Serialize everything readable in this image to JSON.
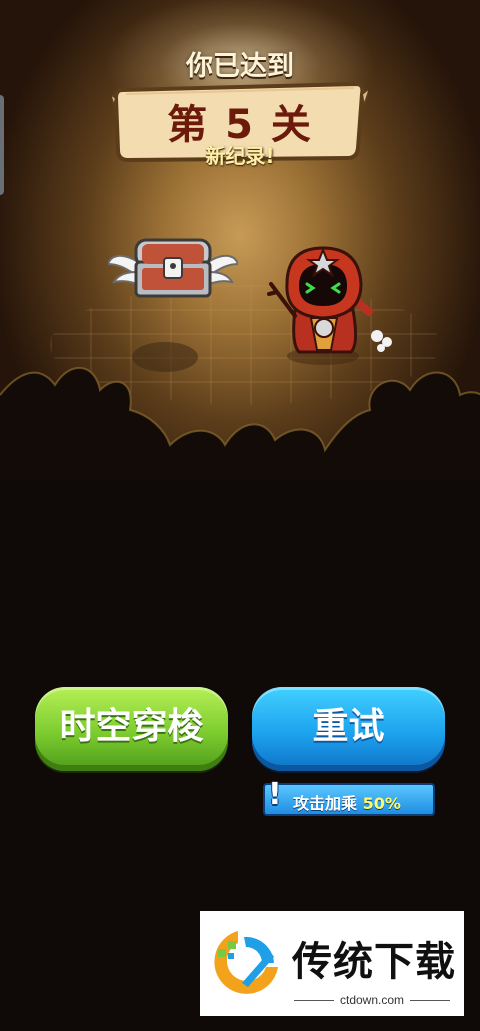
{
  "result": {
    "heading": "你已达到",
    "level_text": "第 5 关",
    "record_text": "新纪录!"
  },
  "actions": {
    "time_travel_label": "时空穿梭",
    "retry_label": "重试",
    "bonus_mark": "!",
    "bonus_text": "攻击加乘",
    "bonus_value": "50%"
  },
  "watermark": {
    "title": "传统下载",
    "url": "ctdown.com"
  },
  "icons": {
    "chest": "winged-treasure-chest-icon",
    "hero": "red-hooded-mage-character",
    "logo": "ctdown-logo-icon"
  },
  "colors": {
    "green_button": "#7ccc2f",
    "blue_button": "#1ca3ef",
    "level_text": "#6b1a0b",
    "record_text": "#fff0a9"
  }
}
